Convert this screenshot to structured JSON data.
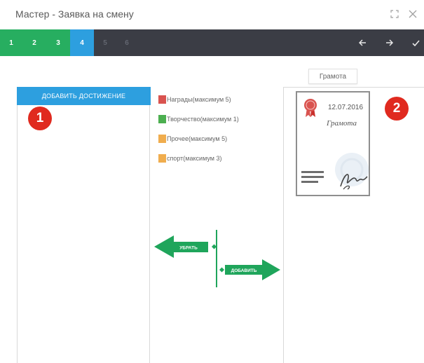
{
  "window": {
    "title": "Мастер - Заявка на смену",
    "expand_icon": "expand-icon",
    "close_icon": "close-icon"
  },
  "steps": [
    {
      "label": "1",
      "state": "done"
    },
    {
      "label": "2",
      "state": "done"
    },
    {
      "label": "3",
      "state": "done"
    },
    {
      "label": "4",
      "state": "active"
    },
    {
      "label": "5",
      "state": "disabled"
    },
    {
      "label": "6",
      "state": "disabled"
    }
  ],
  "nav": {
    "back_icon": "arrow-left-icon",
    "forward_icon": "arrow-right-icon",
    "finish_icon": "check-icon"
  },
  "left_panel": {
    "add_button_label": "ДОБАВИТЬ ДОСТИЖЕНИЕ",
    "badge": "1"
  },
  "legend": [
    {
      "label": "Награды(максимум 5)",
      "color": "#d9534f"
    },
    {
      "label": "Творчество(максимум 1)",
      "color": "#4caf50"
    },
    {
      "label": "Прочее(максимум 5)",
      "color": "#f0ad4e"
    },
    {
      "label": "спорт(максимум 3)",
      "color": "#f0ad4e"
    }
  ],
  "transfer": {
    "remove_label": "УБРАТЬ",
    "add_label": "ДОБАВИТЬ",
    "color": "#1fa55b"
  },
  "right_panel": {
    "badge": "2",
    "tooltip": "Грамота",
    "certificate": {
      "date": "12.07.2016",
      "name": "Грамота",
      "seal_icon": "award-seal-icon",
      "signature_icon": "signature-icon"
    }
  },
  "colors": {
    "accent_blue": "#2d9fdf",
    "step_done": "#27ae60",
    "step_bar": "#3b3d45",
    "badge_red": "#e02a1f"
  }
}
